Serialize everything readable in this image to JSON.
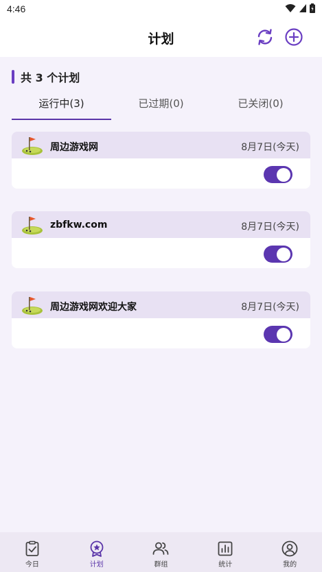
{
  "status_bar": {
    "time": "4:46"
  },
  "header": {
    "title": "计划"
  },
  "section": {
    "title": "共 3 个计划"
  },
  "tabs": [
    {
      "label": "运行中(3)",
      "active": true
    },
    {
      "label": "已过期(0)",
      "active": false
    },
    {
      "label": "已关闭(0)",
      "active": false
    }
  ],
  "plans": [
    {
      "name": "周边游戏网",
      "date": "8月7日(今天)",
      "enabled": true,
      "icon": "golf-flag-icon"
    },
    {
      "name": "zbfkw.com",
      "date": "8月7日(今天)",
      "enabled": true,
      "icon": "golf-flag-icon"
    },
    {
      "name": "周边游戏网欢迎大家",
      "date": "8月7日(今天)",
      "enabled": true,
      "icon": "golf-flag-icon"
    }
  ],
  "bottom_nav": [
    {
      "label": "今日",
      "icon": "clipboard-check-icon",
      "active": false
    },
    {
      "label": "计划",
      "icon": "award-star-icon",
      "active": true
    },
    {
      "label": "群组",
      "icon": "people-icon",
      "active": false
    },
    {
      "label": "统计",
      "icon": "bar-chart-icon",
      "active": false
    },
    {
      "label": "我的",
      "icon": "user-circle-icon",
      "active": false
    }
  ],
  "colors": {
    "accent": "#5b36b0",
    "card_header": "#e8e1f3",
    "background": "#f5f2fb"
  }
}
